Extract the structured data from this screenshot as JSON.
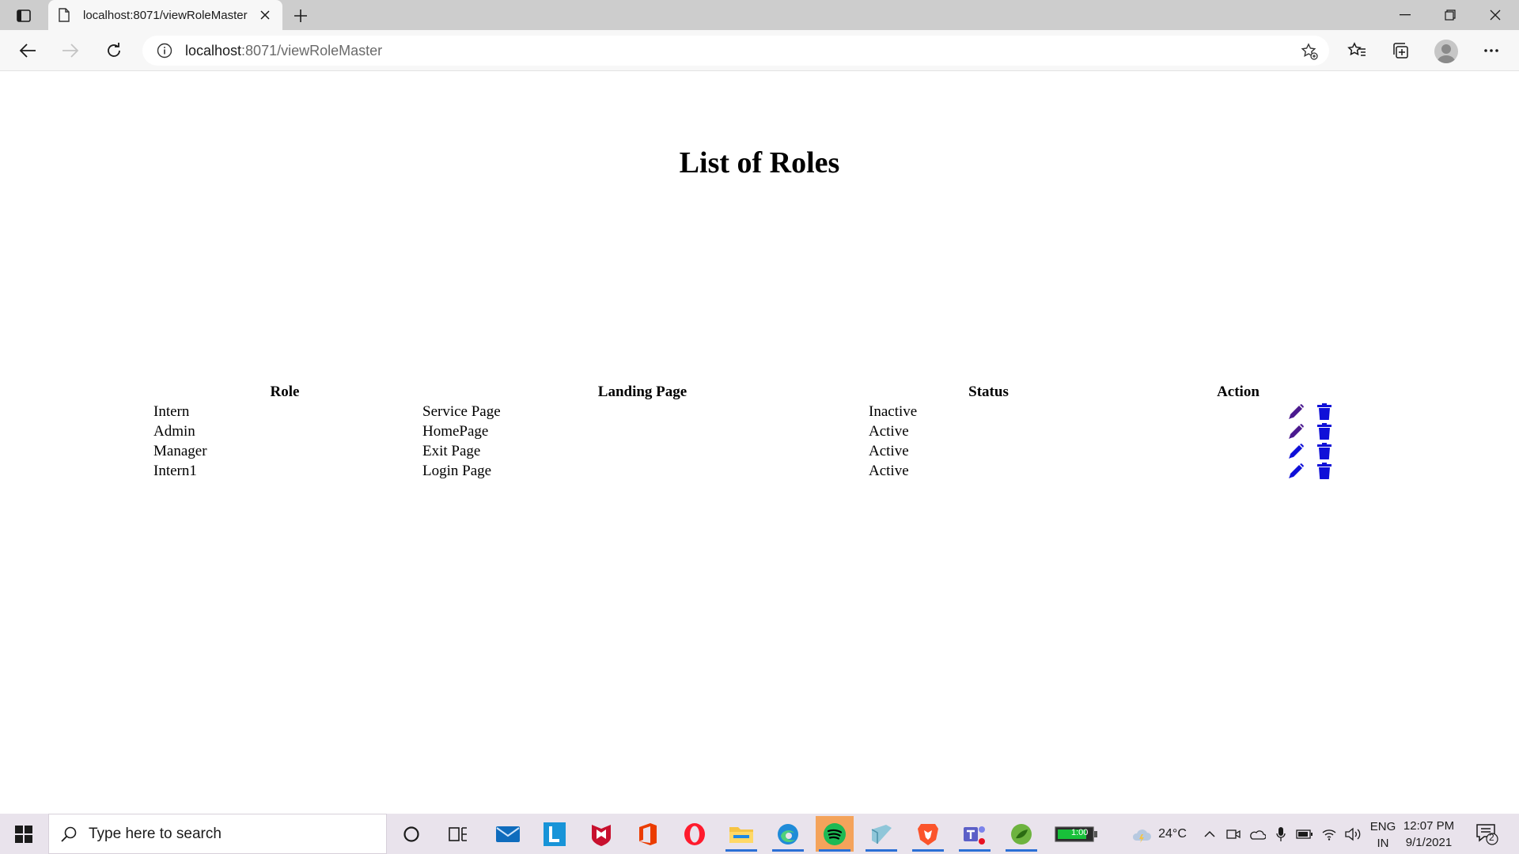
{
  "browser": {
    "tab_title": "localhost:8071/viewRoleMaster",
    "url_host": "localhost",
    "url_path": ":8071/viewRoleMaster"
  },
  "page": {
    "title": "List of Roles",
    "table": {
      "headers": [
        "Role",
        "Landing Page",
        "Status",
        "Action"
      ],
      "rows": [
        {
          "role": "Intern",
          "landing_page": "Service Page",
          "status": "Inactive"
        },
        {
          "role": "Admin",
          "landing_page": "HomePage",
          "status": "Active"
        },
        {
          "role": "Manager",
          "landing_page": "Exit Page",
          "status": "Active"
        },
        {
          "role": "Intern1",
          "landing_page": "Login Page",
          "status": "Active"
        }
      ],
      "actions": [
        "edit-icon",
        "delete-icon"
      ]
    }
  },
  "taskbar": {
    "search_placeholder": "Type here to search",
    "battery_label": "1:00",
    "weather": "24°C",
    "language": "ENG",
    "region": "IN",
    "time": "12:07 PM",
    "date": "9/1/2021",
    "notification_count": "2"
  },
  "colors": {
    "edit_icon": "#4b1a8f",
    "delete_icon": "#1010d8",
    "taskbar_bg": "#e9e3ec",
    "accent": "#2a6fd6"
  }
}
